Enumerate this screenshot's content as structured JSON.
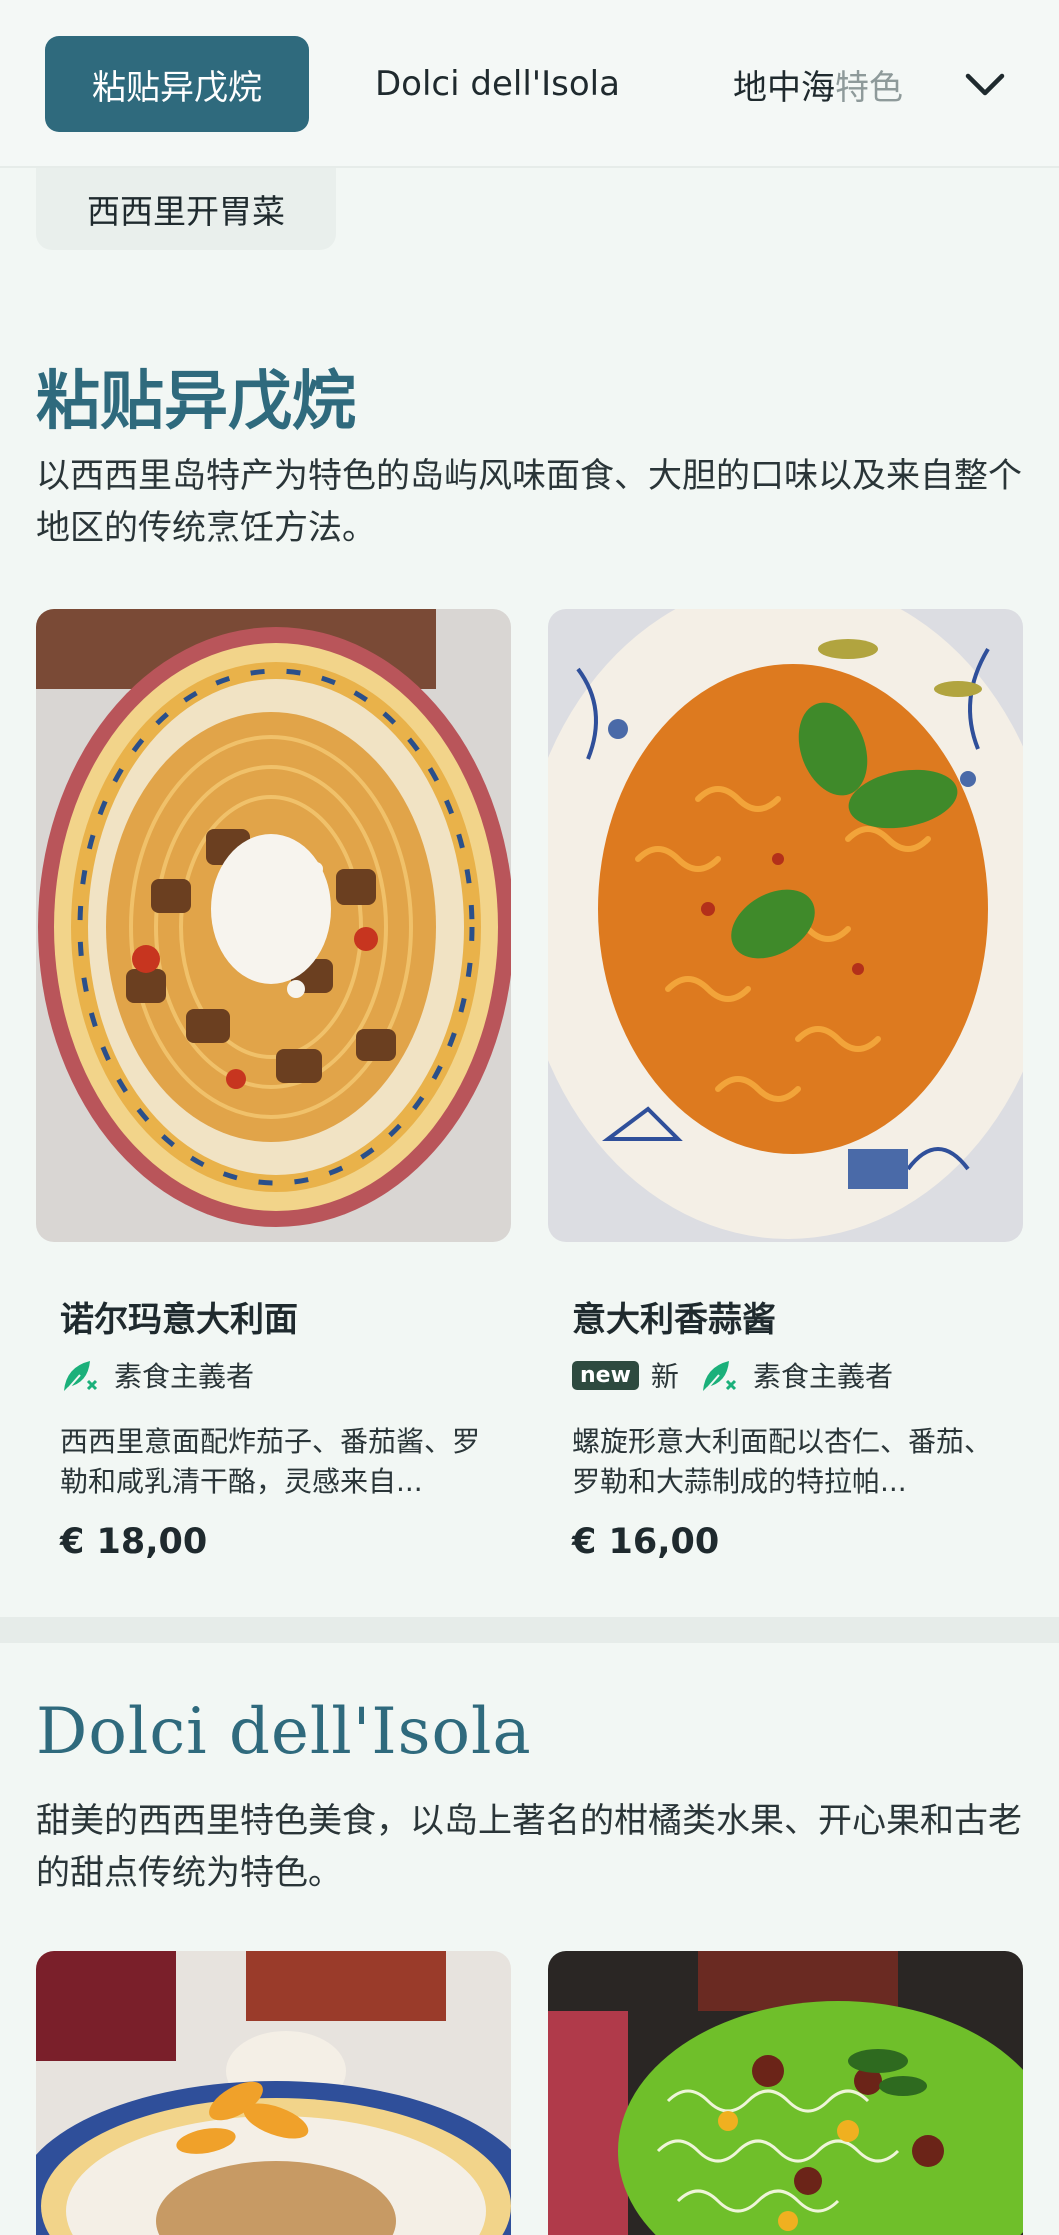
{
  "nav": {
    "tabs": [
      {
        "label": "粘贴异戊烷"
      },
      {
        "label": "Dolci dell'Isola"
      },
      {
        "label_main": "地中海",
        "label_faded": "特色"
      }
    ],
    "subcategory": "西西里开胃菜"
  },
  "sections": [
    {
      "title": "粘贴异戊烷",
      "description": "以西西里岛特产为特色的岛屿风味面食、大胆的口味以及来自整个地区的传统烹饪方法。",
      "dishes": [
        {
          "name": "诺尔玛意大利面",
          "tag": "素食主義者",
          "description": "西西里意面配炸茄子、番茄酱、罗勒和咸乳清干酪，灵感来自...",
          "price": "€ 18,00"
        },
        {
          "name": "意大利香蒜酱",
          "new_badge": "new",
          "new_text": "新",
          "tag": "素食主義者",
          "description": "螺旋形意大利面配以杏仁、番茄、罗勒和大蒜制成的特拉帕...",
          "price": "€ 16,00"
        }
      ]
    },
    {
      "title": "Dolci dell'Isola",
      "description": "甜美的西西里特色美食，以岛上著名的柑橘类水果、开心果和古老的甜点传统为特色。"
    }
  ],
  "colors": {
    "accent": "#2f6a7d",
    "background": "#f2f7f4",
    "vegan_green": "#1bb07a"
  }
}
